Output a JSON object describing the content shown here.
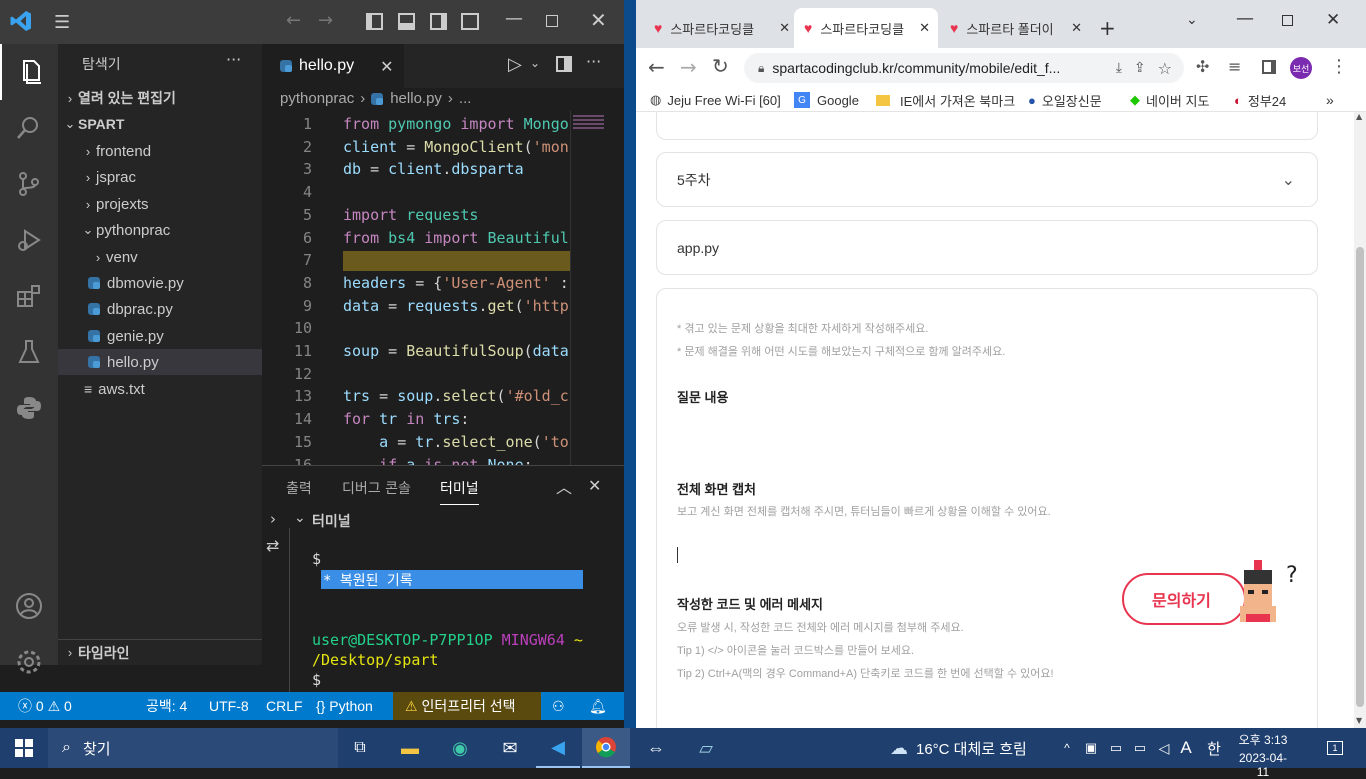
{
  "vscode": {
    "explorer_title": "탐색기",
    "open_editors": "열려 있는 편집기",
    "workspace": "SPART",
    "tree": [
      {
        "label": "frontend",
        "type": "folder",
        "open": false
      },
      {
        "label": "jsprac",
        "type": "folder",
        "open": false
      },
      {
        "label": "projexts",
        "type": "folder",
        "open": false
      },
      {
        "label": "pythonprac",
        "type": "folder",
        "open": true
      },
      {
        "label": "venv",
        "type": "folder",
        "open": false
      },
      {
        "label": "dbmovie.py",
        "type": "py"
      },
      {
        "label": "dbprac.py",
        "type": "py"
      },
      {
        "label": "genie.py",
        "type": "py"
      },
      {
        "label": "hello.py",
        "type": "py",
        "selected": true
      },
      {
        "label": "aws.txt",
        "type": "txt"
      }
    ],
    "timeline": "타임라인",
    "tab_label": "hello.py",
    "breadcrumb_folder": "pythonprac",
    "breadcrumb_file": "hello.py",
    "breadcrumb_more": "...",
    "code_lines": [
      {
        "n": "1",
        "t": [
          [
            "kw",
            "from "
          ],
          [
            "mod",
            "pymongo "
          ],
          [
            "kw",
            "import "
          ],
          [
            "mod",
            "Mongo"
          ]
        ]
      },
      {
        "n": "2",
        "t": [
          [
            "var",
            "client "
          ],
          [
            "plain",
            "= "
          ],
          [
            "fn",
            "MongoClient"
          ],
          [
            "plain",
            "("
          ],
          [
            "str",
            "'mon"
          ]
        ]
      },
      {
        "n": "3",
        "t": [
          [
            "var",
            "db "
          ],
          [
            "plain",
            "= "
          ],
          [
            "var",
            "client"
          ],
          [
            "plain",
            "."
          ],
          [
            "var",
            "dbsparta"
          ]
        ]
      },
      {
        "n": "4",
        "t": []
      },
      {
        "n": "5",
        "t": [
          [
            "kw",
            "import "
          ],
          [
            "mod",
            "requests"
          ]
        ]
      },
      {
        "n": "6",
        "t": [
          [
            "kw",
            "from "
          ],
          [
            "mod",
            "bs4 "
          ],
          [
            "kw",
            "import "
          ],
          [
            "mod",
            "Beautiful"
          ]
        ]
      },
      {
        "n": "7",
        "t": []
      },
      {
        "n": "8",
        "t": [
          [
            "var",
            "headers "
          ],
          [
            "plain",
            "= {"
          ],
          [
            "str",
            "'User-Agent'"
          ],
          [
            "plain",
            " :"
          ]
        ]
      },
      {
        "n": "9",
        "t": [
          [
            "var",
            "data "
          ],
          [
            "plain",
            "= "
          ],
          [
            "var",
            "requests"
          ],
          [
            "plain",
            "."
          ],
          [
            "fn",
            "get"
          ],
          [
            "plain",
            "("
          ],
          [
            "str",
            "'http"
          ]
        ]
      },
      {
        "n": "10",
        "t": []
      },
      {
        "n": "11",
        "t": [
          [
            "var",
            "soup "
          ],
          [
            "plain",
            "= "
          ],
          [
            "fn",
            "BeautifulSoup"
          ],
          [
            "plain",
            "("
          ],
          [
            "var",
            "data"
          ]
        ]
      },
      {
        "n": "12",
        "t": []
      },
      {
        "n": "13",
        "t": [
          [
            "var",
            "trs "
          ],
          [
            "plain",
            "= "
          ],
          [
            "var",
            "soup"
          ],
          [
            "plain",
            "."
          ],
          [
            "fn",
            "select"
          ],
          [
            "plain",
            "("
          ],
          [
            "str",
            "'#old_c"
          ]
        ]
      },
      {
        "n": "14",
        "t": [
          [
            "kw",
            "for "
          ],
          [
            "var",
            "tr "
          ],
          [
            "kw",
            "in "
          ],
          [
            "var",
            "trs"
          ],
          [
            "plain",
            ":"
          ]
        ]
      },
      {
        "n": "15",
        "t": [
          [
            "plain",
            "    "
          ],
          [
            "var",
            "a "
          ],
          [
            "plain",
            "= "
          ],
          [
            "var",
            "tr"
          ],
          [
            "plain",
            "."
          ],
          [
            "fn",
            "select_one"
          ],
          [
            "plain",
            "("
          ],
          [
            "str",
            "'to"
          ]
        ]
      },
      {
        "n": "16",
        "t": [
          [
            "plain",
            "    "
          ],
          [
            "kw",
            "if "
          ],
          [
            "var",
            "a "
          ],
          [
            "kw",
            "is not "
          ],
          [
            "var",
            "None"
          ],
          [
            "plain",
            ":"
          ]
        ]
      }
    ],
    "panel_tabs": [
      "출력",
      "디버그 콘솔",
      "터미널"
    ],
    "terminal_header": "터미널",
    "terminal_prompt": "$",
    "terminal_restored": "*  복원된 기록",
    "terminal_user": "user@DESKTOP-P7PP1OP",
    "terminal_host": "MINGW64",
    "terminal_path_tilde": "~",
    "terminal_path": "/Desktop/spart",
    "terminal_prompt2": "$",
    "status": {
      "errors": "0",
      "warnings": "0",
      "spaces": "공백: 4",
      "encoding": "UTF-8",
      "eol": "CRLF",
      "language": "Python",
      "interpreter": "인터프리터 선택"
    }
  },
  "chrome": {
    "tabs": [
      {
        "label": "스파르타코딩클",
        "active": false
      },
      {
        "label": "스파르타코딩클",
        "active": true
      },
      {
        "label": "스파르타 폴더이",
        "active": false
      }
    ],
    "url": "spartacodingclub.kr/community/mobile/edit_f...",
    "profile": "보선",
    "bookmarks": [
      "Jeju Free Wi-Fi [60]",
      "Google",
      "IE에서 가져온 북마크",
      "오일장신문",
      "네이버 지도",
      "정부24"
    ],
    "week_select": "5주차",
    "file_field": "app.py",
    "guide1": "* 겪고 있는 문제 상황을 최대한 자세하게 작성해주세요.",
    "guide2": "* 문제 해결을 위해 어떤 시도를 해보았는지 구체적으로 함께 알려주세요.",
    "q_title": "질문 내용",
    "cap_title": "전체 화면 캡처",
    "cap_desc": "보고 계신 화면 전체를 캡처해 주시면, 튜터님들이 빠르게 상황을 이해할 수 있어요.",
    "code_title": "작성한 코드 및 에러 메세지",
    "code_desc": "오류 발생 시, 작성한 코드 전체와 에러 메시지를 첨부해 주세요.",
    "tip1": "Tip 1) </> 아이콘을 눌러 코드박스를 만들어 보세요.",
    "tip2": "Tip 2) Ctrl+A(맥의 경우 Command+A) 단축키로 코드를 한 번에 선택할 수 있어요!",
    "ask_button": "문의하기"
  },
  "taskbar": {
    "search": "찾기",
    "weather": "16°C  대체로 흐림",
    "ime": "A",
    "ime2": "한",
    "time": "오후 3:13",
    "date": "2023-04-11",
    "notif": "1"
  },
  "colors": {
    "vscode_blue": "#007acc",
    "spartan_red": "#e8344e",
    "taskbar": "#1f3f6e"
  }
}
